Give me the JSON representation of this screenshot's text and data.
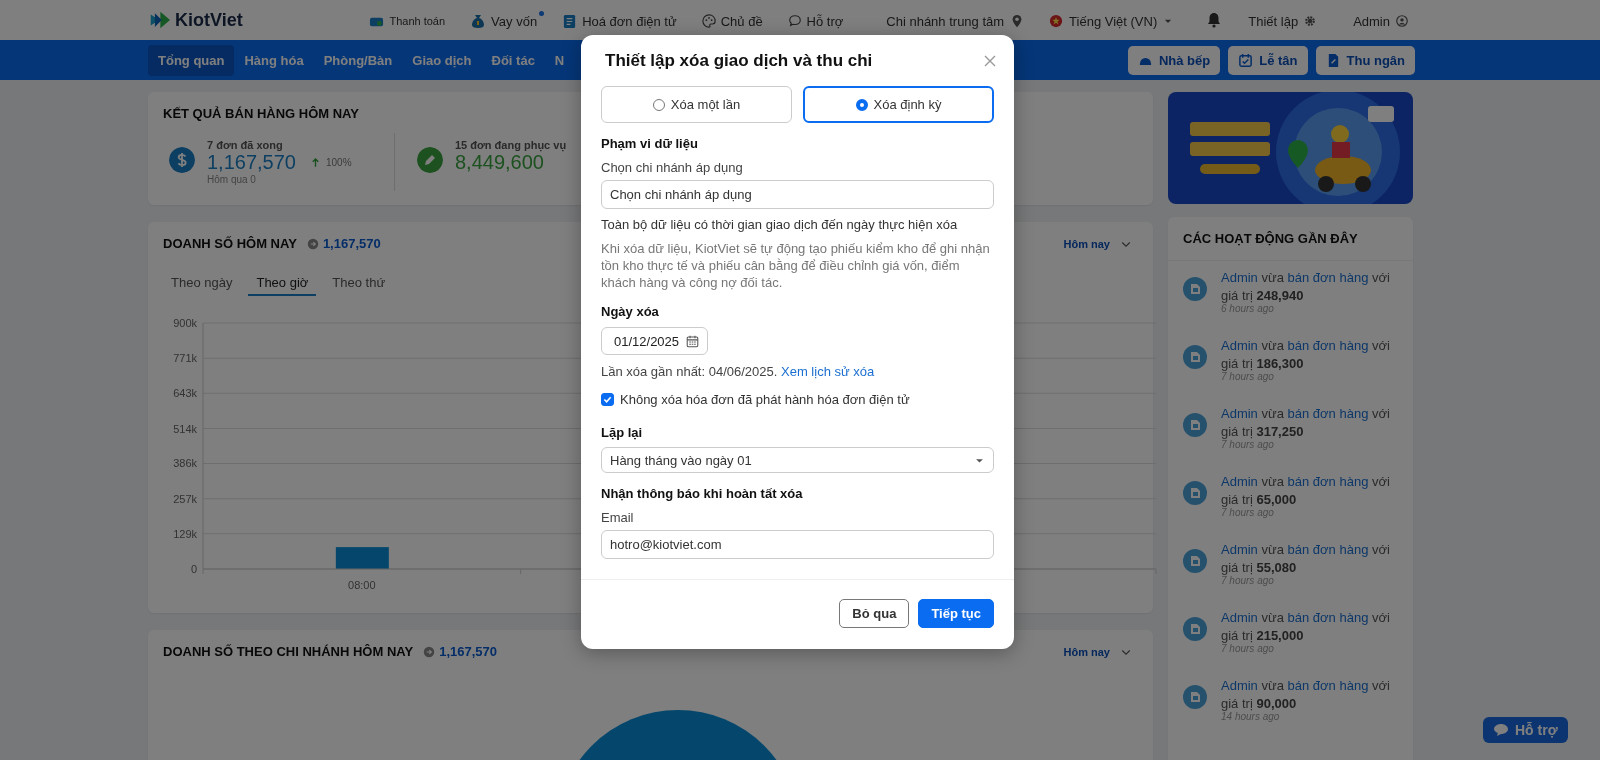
{
  "header": {
    "logo": "KiotViet",
    "links": [
      {
        "kind": "payment",
        "label": "Thanh toán",
        "new": false
      },
      {
        "kind": "loan",
        "label": "Vay vốn",
        "new": true
      },
      {
        "kind": "invoice",
        "label": "Hoá đơn điện tử",
        "new": false
      },
      {
        "kind": "theme",
        "label": "Chủ đề",
        "new": false
      },
      {
        "kind": "support",
        "label": "Hỗ trợ",
        "new": false
      }
    ],
    "branch": "Chi nhánh trung tâm",
    "language": "Tiếng Việt (VN)",
    "settings": "Thiết lập",
    "account": "Admin"
  },
  "nav": {
    "items": [
      {
        "label": "Tổng quan",
        "selected": true
      },
      {
        "label": "Hàng hóa",
        "selected": false
      },
      {
        "label": "Phòng/Bàn",
        "selected": false
      },
      {
        "label": "Giao dịch",
        "selected": false
      },
      {
        "label": "Đối tác",
        "selected": false
      },
      {
        "label": "N",
        "selected": false
      }
    ],
    "actions": [
      {
        "kind": "kitchen",
        "label": "Nhà bếp"
      },
      {
        "kind": "reception",
        "label": "Lễ tân"
      },
      {
        "kind": "cashier",
        "label": "Thu ngân"
      }
    ]
  },
  "summary": {
    "title": "KẾT QUẢ BÁN HÀNG HÔM NAY",
    "stats": [
      {
        "kind": "done",
        "caption": "7 đơn đã xong",
        "value": "1,167,570",
        "change": "100%",
        "note": "Hôm qua 0"
      },
      {
        "kind": "serving",
        "caption": "15 đơn đang phục vụ",
        "value": "8,449,600"
      }
    ]
  },
  "sales": {
    "title": "DOANH SỐ HÔM NAY",
    "total": "1,167,570",
    "period": "Hôm nay",
    "tabs": [
      {
        "label": "Theo ngày",
        "selected": false
      },
      {
        "label": "Theo giờ",
        "selected": true
      },
      {
        "label": "Theo thứ",
        "selected": false
      }
    ],
    "chart_data": {
      "type": "bar",
      "categories": [
        "08:00",
        null,
        null
      ],
      "grid": true,
      "ylim": [
        0,
        900000
      ],
      "yticks": [
        {
          "value": 0,
          "label": "0"
        },
        {
          "value": 129000,
          "label": "129k"
        },
        {
          "value": 257000,
          "label": "257k"
        },
        {
          "value": 386000,
          "label": "386k"
        },
        {
          "value": 514000,
          "label": "514k"
        },
        {
          "value": 643000,
          "label": "643k"
        },
        {
          "value": 771000,
          "label": "771k"
        },
        {
          "value": 900000,
          "label": "900k"
        }
      ],
      "series": [
        {
          "color": "#0a8fd8",
          "values": [
            80000,
            null,
            null
          ]
        }
      ]
    }
  },
  "branch_sales": {
    "title": "DOANH SỐ THEO CHI NHÁNH HÔM NAY",
    "total": "1,167,570",
    "period": "Hôm nay"
  },
  "activity": {
    "title": "CÁC HOẠT ĐỘNG GẦN ĐÂY",
    "items": [
      {
        "actor": "Admin",
        "verb": "vừa",
        "action": "bán đơn hàng",
        "tail": "với",
        "value_label": "giá trị",
        "value": "248,940",
        "time": "6 hours ago"
      },
      {
        "actor": "Admin",
        "verb": "vừa",
        "action": "bán đơn hàng",
        "tail": "với",
        "value_label": "giá trị",
        "value": "186,300",
        "time": "7 hours ago"
      },
      {
        "actor": "Admin",
        "verb": "vừa",
        "action": "bán đơn hàng",
        "tail": "với",
        "value_label": "giá trị",
        "value": "317,250",
        "time": "7 hours ago"
      },
      {
        "actor": "Admin",
        "verb": "vừa",
        "action": "bán đơn hàng",
        "tail": "với",
        "value_label": "giá trị",
        "value": "65,000",
        "time": "7 hours ago"
      },
      {
        "actor": "Admin",
        "verb": "vừa",
        "action": "bán đơn hàng",
        "tail": "với",
        "value_label": "giá trị",
        "value": "55,080",
        "time": "7 hours ago"
      },
      {
        "actor": "Admin",
        "verb": "vừa",
        "action": "bán đơn hàng",
        "tail": "với",
        "value_label": "giá trị",
        "value": "215,000",
        "time": "7 hours ago"
      },
      {
        "actor": "Admin",
        "verb": "vừa",
        "action": "bán đơn hàng",
        "tail": "với",
        "value_label": "giá trị",
        "value": "90,000",
        "time": "14 hours ago"
      }
    ]
  },
  "help_button": {
    "label": "Hỗ trợ"
  },
  "dialog": {
    "title": "Thiết lập xóa giao dịch và thu chi",
    "modes": [
      {
        "label": "Xóa một lần",
        "selected": false
      },
      {
        "label": "Xóa định kỳ",
        "selected": true
      }
    ],
    "scope": {
      "heading": "Phạm vi dữ liệu",
      "branch_label": "Chọn chi nhánh áp dụng",
      "branch_placeholder": "Chọn chi nhánh áp dụng",
      "note": "Toàn bộ dữ liệu có thời gian giao dịch đến ngày thực hiện xóa",
      "info": "Khi xóa dữ liệu, KiotViet sẽ tự động tạo phiếu kiểm kho để ghi nhận tồn kho thực tế và phiếu cân bằng để điều chỉnh giá vốn, điểm khách hàng và công nợ đối tác."
    },
    "date": {
      "heading": "Ngày xóa",
      "value": "01/12/2025",
      "last_text": "Lần xóa gần nhất: 04/06/2025.",
      "history_link": "Xem lịch sử xóa"
    },
    "keep_einvoice": {
      "label": "Không xóa hóa đơn đã phát hành hóa đơn điện tử",
      "checked": true
    },
    "repeat": {
      "heading": "Lặp lại",
      "value": "Hàng tháng vào ngày 01"
    },
    "notify": {
      "heading": "Nhận thông báo khi hoàn tất xóa",
      "email_label": "Email",
      "email": "hotro@kiotviet.com"
    },
    "buttons": [
      {
        "kind": "secondary",
        "label": "Bỏ qua"
      },
      {
        "kind": "primary",
        "label": "Tiếp tục"
      }
    ]
  }
}
